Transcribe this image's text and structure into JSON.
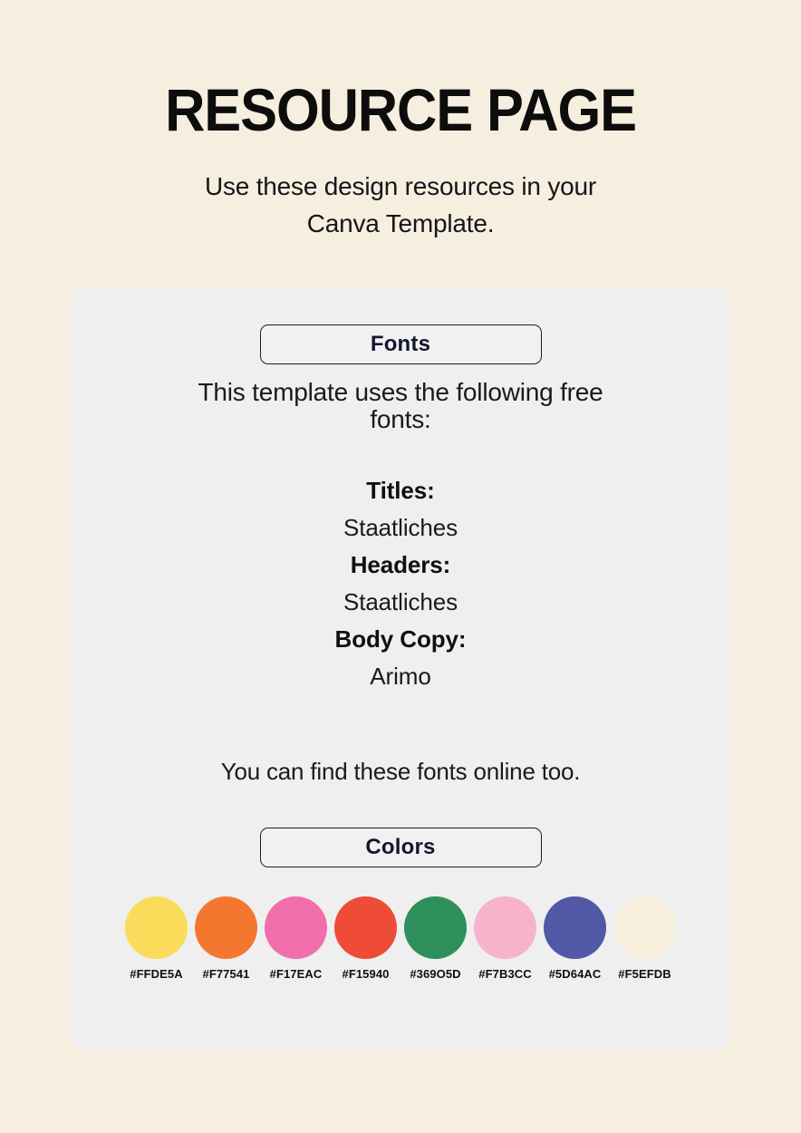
{
  "header": {
    "title": "RESOURCE PAGE",
    "subtitle": "Use these design resources in your Canva Template."
  },
  "panel": {
    "fonts_section": {
      "badge_label": "Fonts",
      "intro": "This template uses the following free fonts:",
      "entries": [
        {
          "role": "Titles:",
          "font": "Staatliches"
        },
        {
          "role": "Headers:",
          "font": "Staatliches"
        },
        {
          "role": "Body Copy:",
          "font": "Arimo"
        }
      ],
      "outro": "You can find these fonts online too."
    },
    "colors_section": {
      "badge_label": "Colors",
      "swatches": [
        {
          "hex_label": "#FFDE5A",
          "color": "#FBDC5A"
        },
        {
          "hex_label": "#F77541",
          "color": "#F4772F"
        },
        {
          "hex_label": "#F17EAC",
          "color": "#F06FAB"
        },
        {
          "hex_label": "#F15940",
          "color": "#EE4C37"
        },
        {
          "hex_label": "#369O5D",
          "color": "#2F8F5B"
        },
        {
          "hex_label": "#F7B3CC",
          "color": "#F8B3CC"
        },
        {
          "hex_label": "#5D64AC",
          "color": "#5158A5"
        },
        {
          "hex_label": "#F5EFDB",
          "color": "#F8F0DC"
        }
      ]
    }
  },
  "theme": {
    "background": "#F6EFDF",
    "panel_background": "#EFEFF0",
    "badge_border": "#1B1D3A",
    "text": "#1A1A1A"
  }
}
